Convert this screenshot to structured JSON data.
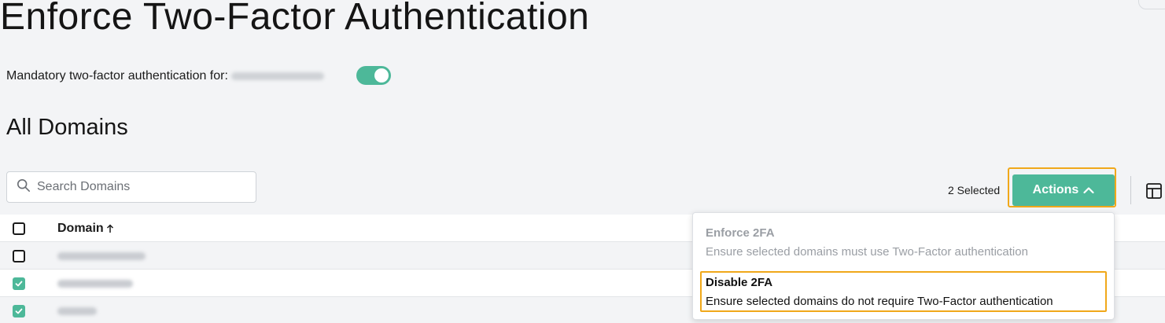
{
  "page": {
    "title": "Enforce Two-Factor Authentication"
  },
  "mandatory": {
    "label": "Mandatory two-factor authentication for:",
    "enabled": true
  },
  "section": {
    "title": "All Domains"
  },
  "search": {
    "placeholder": "Search Domains",
    "value": ""
  },
  "toolbar": {
    "selected_count": "2 Selected",
    "actions_label": "Actions"
  },
  "table": {
    "columns": [
      {
        "label": "Domain",
        "sort": "ascending"
      }
    ],
    "rows": [
      {
        "checked": false
      },
      {
        "checked": true
      },
      {
        "checked": true
      }
    ]
  },
  "actions_menu": {
    "items": [
      {
        "title": "Enforce 2FA",
        "description": "Ensure selected domains must use Two-Factor authentication",
        "disabled": true
      },
      {
        "title": "Disable 2FA",
        "description": "Ensure selected domains do not require Two-Factor authentication",
        "disabled": false
      }
    ]
  },
  "colors": {
    "accent": "#4db899",
    "highlight": "#f0a81a",
    "background": "#f3f4f6"
  },
  "icons": {
    "search": "search-icon",
    "chevron": "chevron-up-icon",
    "sort": "arrow-up-icon",
    "columns": "columns-icon",
    "check": "check-icon"
  }
}
